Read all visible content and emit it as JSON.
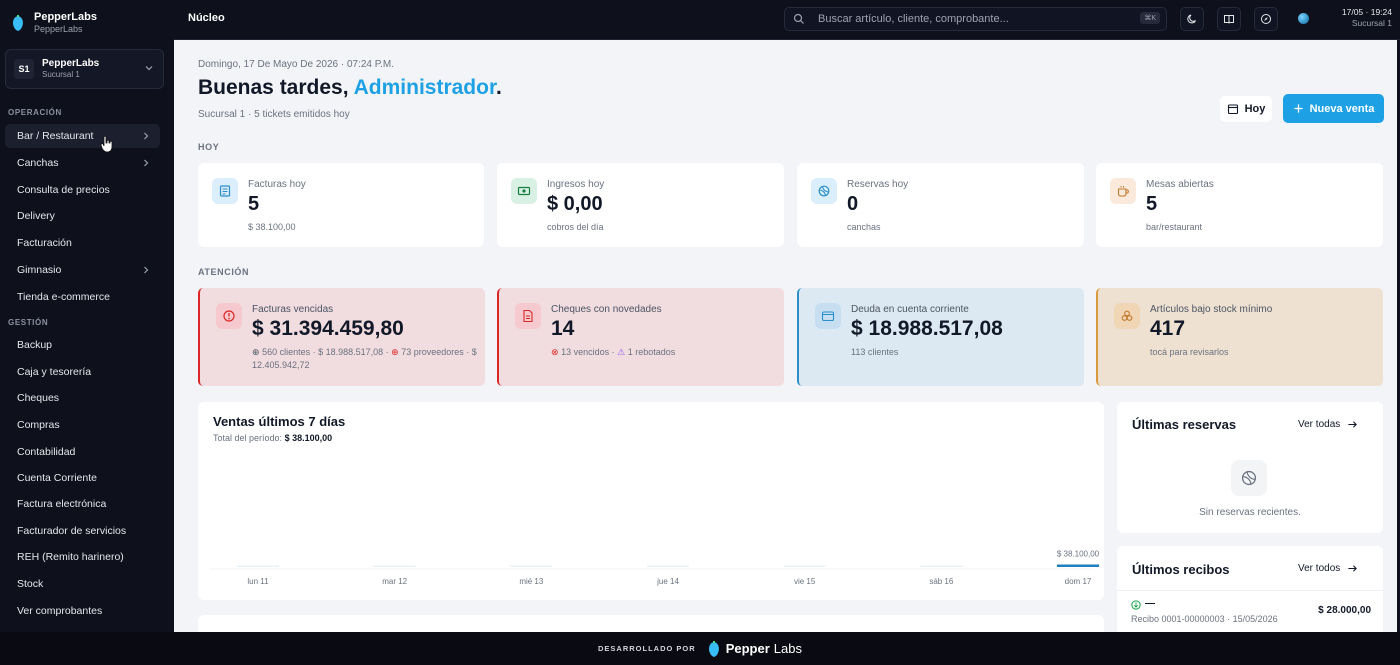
{
  "brand": {
    "name": "PepperLabs",
    "sub": "PepperLabs"
  },
  "branch": {
    "badge": "S1",
    "name": "PepperLabs",
    "sub": "Sucursal 1"
  },
  "sidebar": {
    "sections": [
      {
        "title": "OPERACIÓN"
      },
      {
        "title": "GESTIÓN"
      }
    ],
    "items": [
      {
        "label": "Bar / Restaurant"
      },
      {
        "label": "Canchas"
      },
      {
        "label": "Consulta de precios"
      },
      {
        "label": "Delivery"
      },
      {
        "label": "Facturación"
      },
      {
        "label": "Gimnasio"
      },
      {
        "label": "Tienda e-commerce"
      },
      {
        "label": "Backup"
      },
      {
        "label": "Caja y tesorería"
      },
      {
        "label": "Cheques"
      },
      {
        "label": "Compras"
      },
      {
        "label": "Contabilidad"
      },
      {
        "label": "Cuenta Corriente"
      },
      {
        "label": "Factura electrónica"
      },
      {
        "label": "Facturador de servicios"
      },
      {
        "label": "REH (Remito harinero)"
      },
      {
        "label": "Stock"
      },
      {
        "label": "Ver comprobantes"
      }
    ]
  },
  "topbar": {
    "crumb": "Núcleo",
    "search_placeholder": "Buscar artículo, cliente, comprobante...",
    "shortcut": "⌘K",
    "date": "17/05 · 19:24",
    "branch": "Sucursal 1"
  },
  "header": {
    "date": "Domingo, 17 De Mayo De 2026 · 07:24 P.M.",
    "greeting": "Buenas tardes,",
    "user": "Administrador",
    "dot": ".",
    "sub": "Sucursal 1 · 5 tickets emitidos hoy",
    "btn_today": "Hoy",
    "btn_new": "Nueva venta"
  },
  "today": {
    "title": "HOY",
    "cards": [
      {
        "label": "Facturas hoy",
        "value": "5",
        "note": "$ 38.100,00"
      },
      {
        "label": "Ingresos hoy",
        "value": "$ 0,00",
        "note": "cobros del día"
      },
      {
        "label": "Reservas hoy",
        "value": "0",
        "note": "canchas"
      },
      {
        "label": "Mesas abiertas",
        "value": "5",
        "note": "bar/restaurant"
      }
    ]
  },
  "attention": {
    "title": "ATENCIÓN",
    "cards": [
      {
        "label": "Facturas vencidas",
        "value": "$ 31.394.459,80",
        "n1": "560 clientes · $ 18.988.517,08 ·",
        "n2": "73 proveedores",
        "n3": "· $ 12.405.942,72"
      },
      {
        "label": "Cheques con novedades",
        "value": "14",
        "n1": "13 vencidos ·",
        "n2": "1 rebotados"
      },
      {
        "label": "Deuda en cuenta corriente",
        "value": "$ 18.988.517,08",
        "n1": "113 clientes"
      },
      {
        "label": "Artículos bajo stock mínimo",
        "value": "417",
        "n1": "tocá para revisarlos"
      }
    ],
    "colors": {
      "red": "#dc2626",
      "blue": "#2a8fc9",
      "amber": "#d99a3d"
    }
  },
  "sales": {
    "title": "Ventas últimos 7 días",
    "total_label": "Total del período:",
    "total_value": "$ 38.100,00",
    "peak_label": "$ 38.100,00",
    "days": [
      "lun 11",
      "mar 12",
      "mié 13",
      "jue 14",
      "vie 15",
      "sáb 16",
      "dom 17"
    ]
  },
  "chart_data": {
    "type": "bar",
    "categories": [
      "lun 11",
      "mar 12",
      "mié 13",
      "jue 14",
      "vie 15",
      "sáb 16",
      "dom 17"
    ],
    "values": [
      0,
      0,
      0,
      0,
      0,
      0,
      38100
    ],
    "title": "Ventas últimos 7 días"
  },
  "reservations": {
    "title": "Últimas reservas",
    "link": "Ver todas",
    "empty": "Sin reservas recientes."
  },
  "receipts": {
    "title": "Últimos recibos",
    "link": "Ver todos",
    "items": [
      {
        "name": "—",
        "detail": "Recibo 0001-00000003 · 15/05/2026",
        "amount": "$ 28.000,00"
      }
    ]
  },
  "footer": {
    "dev": "DESARROLLADO POR",
    "brand_a": "Pepper",
    "brand_b": "Labs"
  }
}
